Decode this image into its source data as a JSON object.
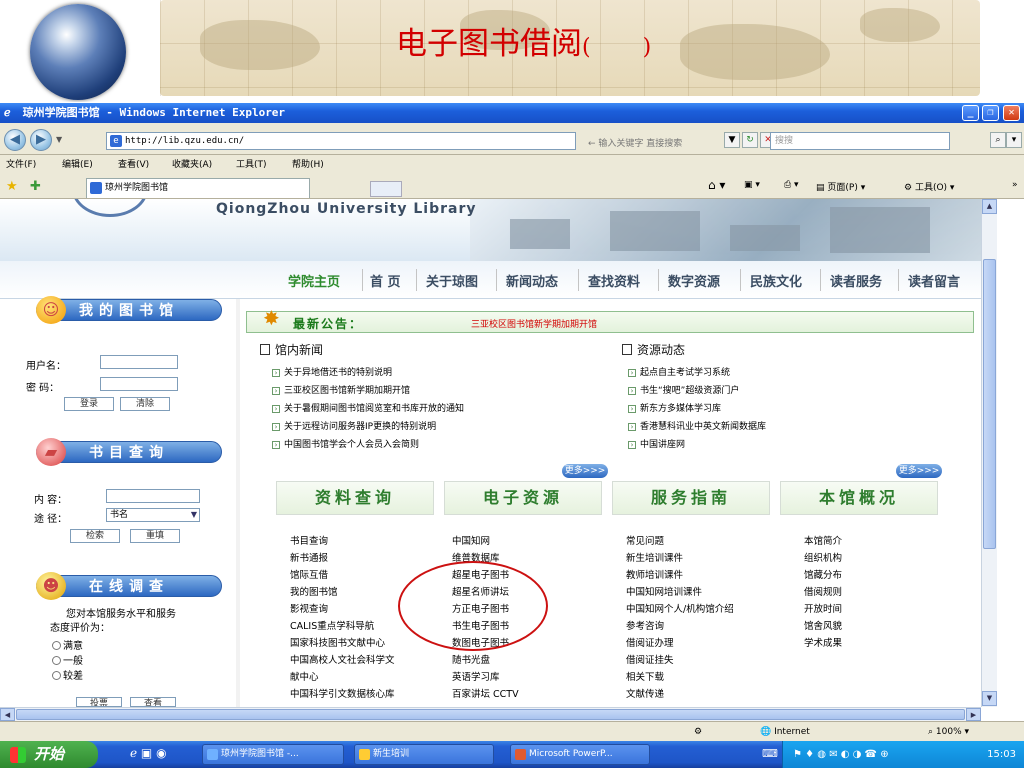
{
  "slide": {
    "title": "电子图书借阅",
    "paren_open": "(",
    "paren_close": ")"
  },
  "window": {
    "title": "琼州学院图书馆 - Windows Internet Explorer"
  },
  "address": {
    "url": "http://lib.qzu.edu.cn/",
    "keyword_hint": "← 输入关键字 直接搜索",
    "search_placeholder": "搜搜"
  },
  "menu": [
    "文件(F)",
    "编辑(E)",
    "查看(V)",
    "收藏夹(A)",
    "工具(T)",
    "帮助(H)"
  ],
  "favorites": {
    "tab_label": "琼州学院图书馆",
    "page_label": "页面(P)",
    "tools_label": "工具(O)"
  },
  "header": {
    "university_en": "QiongZhou University Library"
  },
  "nav": [
    "学院主页",
    "首 页",
    "关于琼图",
    "新闻动态",
    "查找资料",
    "数字资源",
    "民族文化",
    "读者服务",
    "读者留言"
  ],
  "my_library": {
    "title": "我的图书馆",
    "username_label": "用户名：",
    "password_label": "密  码：",
    "login_button": "登录",
    "clear_button": "清除"
  },
  "catalog": {
    "title": "书目查询",
    "content_label": "内  容：",
    "path_label": "途  径：",
    "path_value": "书名",
    "search_button": "检索",
    "reset_button": "重填"
  },
  "survey": {
    "title": "在线调查",
    "question_line1": "您对本馆服务水平和服务",
    "question_line2": "态度评价为：",
    "options": [
      "满意",
      "一般",
      "较差"
    ],
    "vote_button": "投票",
    "view_button": "查看"
  },
  "notice": {
    "label": "最新公告：",
    "text": "三亚校区图书馆新学期加期开馆"
  },
  "news": {
    "title": "馆内新闻",
    "items": [
      "关于异地借还书的特别说明",
      "三亚校区图书馆新学期加期开馆",
      "关于暑假期间图书馆阅览室和书库开放的通知",
      "关于远程访问服务器IP更换的特别说明",
      "中国图书馆学会个人会员入会简则"
    ],
    "more": "更多>>>"
  },
  "resources": {
    "title": "资源动态",
    "items": [
      "起点自主考试学习系统",
      "书生“搜吧”超级资源门户",
      "新东方多媒体学习库",
      "香港慧科讯业中英文新闻数据库",
      "中国讲座网"
    ],
    "more": "更多>>>"
  },
  "tabs": [
    "资料查询",
    "电子资源",
    "服务指南",
    "本馆概况"
  ],
  "columns": [
    [
      "书目查询",
      "新书通报",
      "馆际互借",
      "我的图书馆",
      "影视查询",
      "CALIS重点学科导航",
      "国家科技图书文献中心",
      "中国高校人文社会科学文",
      "献中心",
      "中国科学引文数据核心库"
    ],
    [
      "中国知网",
      "维普数据库",
      "超星电子图书",
      "超星名师讲坛",
      "方正电子图书",
      "书生电子图书",
      "数图电子图书",
      "随书光盘",
      "英语学习库",
      "百家讲坛 CCTV"
    ],
    [
      "常见问题",
      "新生培训课件",
      "教师培训课件",
      "中国知网培训课件",
      "中国知网个人/机构馆介绍",
      "参考咨询",
      "借阅证办理",
      "借阅证挂失",
      "相关下载",
      "文献传递"
    ],
    [
      "本馆简介",
      "组织机构",
      "馆藏分布",
      "借阅规则",
      "开放时间",
      "馆舍风貌",
      "学术成果"
    ]
  ],
  "status": {
    "zone": "Internet",
    "zoom": "100%"
  },
  "taskbar": {
    "start": "开始",
    "tasks": [
      "琼州学院图书馆 -...",
      "新生培训",
      "Microsoft PowerP..."
    ],
    "clock": "15:03"
  }
}
